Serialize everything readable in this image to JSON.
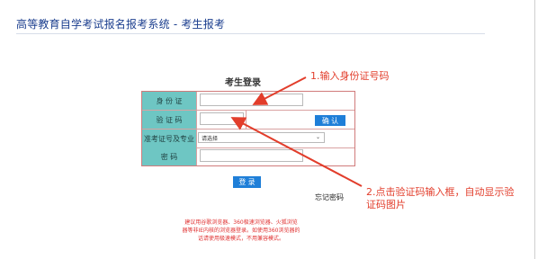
{
  "header": {
    "title": "高等教育自学考试报名报考系统 - 考生报考"
  },
  "login": {
    "title": "考生登录",
    "fields": {
      "id_label": "身 份 证",
      "captcha_label": "验 证 码",
      "captcha_button": "确 认",
      "exam_label": "准考证号及专业",
      "exam_select_value": "请选择",
      "password_label": "密 码"
    },
    "submit_label": "登 录",
    "forgot_label": "忘记密码",
    "notice_line1": "建议用谷歌浏览器、360极速浏览器、火狐浏览",
    "notice_line2": "器等非IE内核的浏览器登录。如使用360浏览器的",
    "notice_line3": "话请使用极速模式，不用兼容模式。"
  },
  "annotations": {
    "note1": "1.输入身份证号码",
    "note2": "2.点击验证码输入框，自动显示验证码图片",
    "color": "#e23d2b"
  },
  "colors": {
    "accent": "#1f7fd8",
    "label_bg": "#6ec6c3",
    "title": "#1c3f8f",
    "notice": "#e03030"
  }
}
